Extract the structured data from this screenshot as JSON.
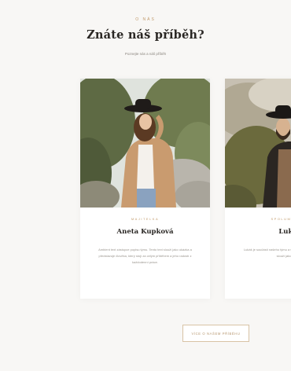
{
  "section": {
    "eyebrow": "O NÁS",
    "title": "Znáte náš příběh?",
    "subtitle": "Poznejte nás a náš příběh"
  },
  "team": [
    {
      "role": "MAJITELKA",
      "name": "Aneta Kupková",
      "bio": "Ambient text zástupce popisu týmu. Tento text slouží jako ukázka a představuje člověka, který stojí za celým příběhem a jeho radostí z každodenní práce."
    },
    {
      "role": "SPOLUMAJITEL",
      "name": "Lukáš",
      "bio": "Lukáš je součástí našeho týmu a stará se o celý příběh. Tento text slouží jako ukázka."
    }
  ],
  "cta": {
    "label": "VÍCE O NAŠEM PŘÍBĚHU"
  },
  "colors": {
    "accent": "#c19a6b",
    "background": "#f8f7f5",
    "heading": "#2a2724"
  }
}
